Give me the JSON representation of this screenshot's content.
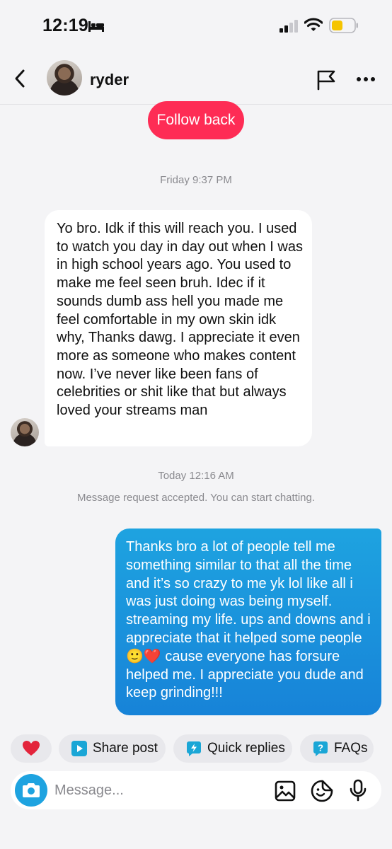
{
  "status_bar": {
    "time": "12:19",
    "icons": [
      "bed-icon",
      "signal-icon",
      "wifi-icon",
      "battery-icon"
    ],
    "battery_color": "#f5c400"
  },
  "header": {
    "username": "ryder",
    "icons": [
      "back-icon",
      "flag-icon",
      "more-icon"
    ]
  },
  "follow_back_label": "Follow back",
  "conversation": {
    "timestamp_1": "Friday 9:37 PM",
    "incoming_message": "Yo bro. Idk if this will reach you. I used to watch you day in day out when I was in high school years ago. You used to make me feel seen bruh. Idec if it sounds dumb ass hell you made me feel comfortable in my own skin idk why, Thanks dawg. I appreciate it even more as someone who makes content now. I’ve never like been fans of celebrities or shit like that but always loved your streams man",
    "timestamp_2": "Today 12:16 AM",
    "system_message": "Message request accepted. You can start chatting.",
    "outgoing_message": "Thanks bro a lot of people tell me something similar to that all the time and it’s so crazy to me yk lol like all i was just doing was being myself. streaming my life. ups and downs and i appreciate that it helped some people 🙂❤️ cause everyone has forsure helped me. I appreciate you dude and keep grinding!!!"
  },
  "quick_actions": {
    "share_post": "Share post",
    "quick_replies": "Quick replies",
    "faqs": "FAQs"
  },
  "composer": {
    "placeholder": "Message..."
  },
  "colors": {
    "accent_pink": "#fe2c55",
    "outgoing_bubble": "#1a94dd",
    "chip_icon": "#1aa6d6"
  }
}
